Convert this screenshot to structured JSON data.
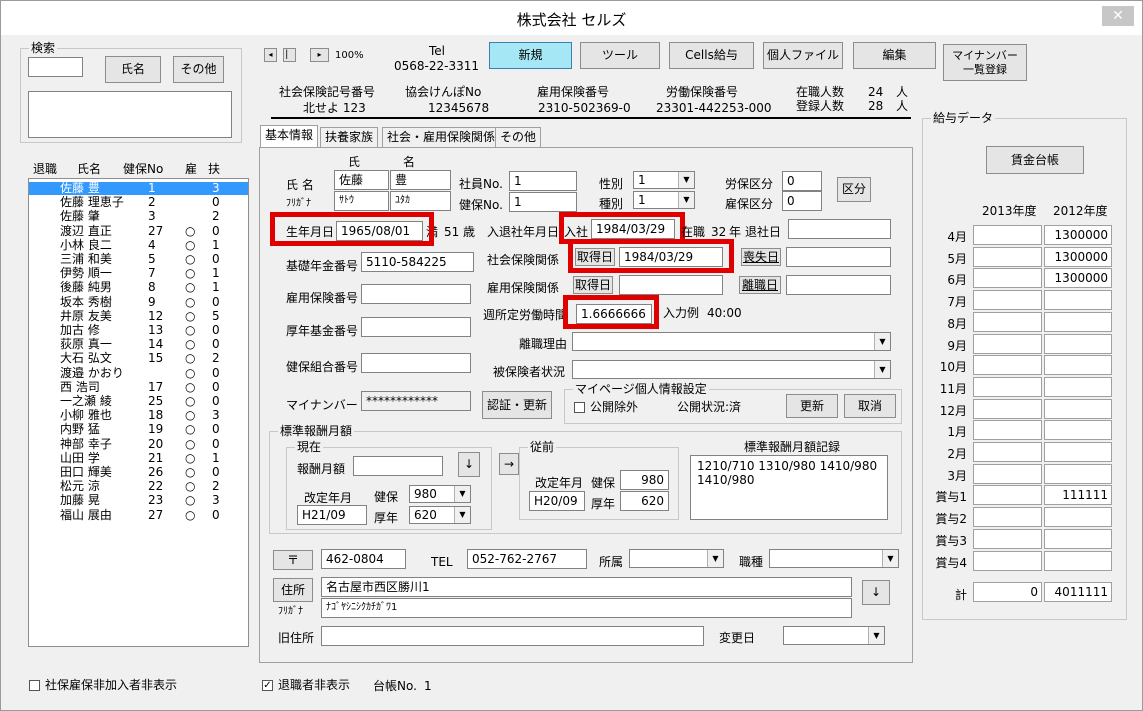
{
  "window": {
    "title": "株式会社 セルズ",
    "close_glyph": "✕"
  },
  "search": {
    "caption": "検索",
    "input_value": "",
    "name_button": "氏名",
    "other_button": "その他",
    "memo_value": ""
  },
  "list_headers": {
    "retired": "退職",
    "name": "氏名",
    "kenpo_no": "健保No",
    "koyo": "雇",
    "fuyo": "扶"
  },
  "employees": [
    {
      "name": "佐藤 豊",
      "no": "1",
      "koyo": "",
      "fuyo": "3"
    },
    {
      "name": "佐藤 理恵子",
      "no": "2",
      "koyo": "",
      "fuyo": "0"
    },
    {
      "name": "佐藤 肇",
      "no": "3",
      "koyo": "",
      "fuyo": "2"
    },
    {
      "name": "渡辺 直正",
      "no": "27",
      "koyo": "○",
      "fuyo": "0"
    },
    {
      "name": "小林 良二",
      "no": "4",
      "koyo": "○",
      "fuyo": "1"
    },
    {
      "name": "三浦 和美",
      "no": "5",
      "koyo": "○",
      "fuyo": "0"
    },
    {
      "name": "伊勢 順一",
      "no": "7",
      "koyo": "○",
      "fuyo": "1"
    },
    {
      "name": "後藤 純男",
      "no": "8",
      "koyo": "○",
      "fuyo": "1"
    },
    {
      "name": "坂本 秀樹",
      "no": "9",
      "koyo": "○",
      "fuyo": "0"
    },
    {
      "name": "井原 友美",
      "no": "12",
      "koyo": "○",
      "fuyo": "5"
    },
    {
      "name": "加古 修",
      "no": "13",
      "koyo": "○",
      "fuyo": "0"
    },
    {
      "name": "荻原 真一",
      "no": "14",
      "koyo": "○",
      "fuyo": "0"
    },
    {
      "name": "大石 弘文",
      "no": "15",
      "koyo": "○",
      "fuyo": "2"
    },
    {
      "name": "渡邉 かおり",
      "no": "",
      "koyo": "○",
      "fuyo": "0"
    },
    {
      "name": "西 浩司",
      "no": "17",
      "koyo": "○",
      "fuyo": "0"
    },
    {
      "name": "一之瀬 綾",
      "no": "25",
      "koyo": "○",
      "fuyo": "0"
    },
    {
      "name": "小柳 雅也",
      "no": "18",
      "koyo": "○",
      "fuyo": "3"
    },
    {
      "name": "内野 猛",
      "no": "19",
      "koyo": "○",
      "fuyo": "0"
    },
    {
      "name": "神部 幸子",
      "no": "20",
      "koyo": "○",
      "fuyo": "0"
    },
    {
      "name": "山田 学",
      "no": "21",
      "koyo": "○",
      "fuyo": "1"
    },
    {
      "name": "田口 輝美",
      "no": "26",
      "koyo": "○",
      "fuyo": "0"
    },
    {
      "name": "松元 涼",
      "no": "22",
      "koyo": "○",
      "fuyo": "2"
    },
    {
      "name": "加藤 晃",
      "no": "23",
      "koyo": "○",
      "fuyo": "3"
    },
    {
      "name": "福山 展由",
      "no": "27",
      "koyo": "○",
      "fuyo": "0"
    }
  ],
  "bottom": {
    "hide_uninsured_label": "社保雇保非加入者非表示",
    "hide_retired_label": "退職者非表示",
    "ledger_label": "台帳No.",
    "ledger_no": "1",
    "hide_retired_checked": "✓"
  },
  "toolbar": {
    "nav_first": "◂",
    "nav_prev": "▏",
    "nav_next": "▸",
    "zoom": "100%",
    "tel_label": "Tel",
    "tel_value": "0568-22-3311",
    "new_button": "新規",
    "tool_button": "ツール",
    "cells_button": "Cells給与",
    "personal_file_button": "個人ファイル",
    "edit_button": "編集",
    "mynumber_button_line1": "マイナンバー",
    "mynumber_button_line2": "一覧登録"
  },
  "company_info": {
    "shaho_label": "社会保険記号番号",
    "shaho_value": "北せよ 123",
    "kenpo_label": "協会けんぽNo",
    "kenpo_value": "12345678",
    "koyo_label": "雇用保険番号",
    "koyo_value": "2310-502369-0",
    "rodo_label": "労働保険番号",
    "rodo_value": "23301-442253-000",
    "zaishoku_label": "在職人数",
    "zaishoku_value": "24",
    "zaishoku_unit": "人",
    "toroku_label": "登録人数",
    "toroku_value": "28",
    "toroku_unit": "人"
  },
  "tabs": [
    "基本情報",
    "扶養家族",
    "社会・雇用保険関係",
    "その他"
  ],
  "basic": {
    "sei_header": "氏",
    "mei_header": "名",
    "name_label": "氏 名",
    "sei": "佐藤",
    "mei": "豊",
    "furigana_label": "ﾌﾘｶﾞﾅ",
    "sei_kana": "ｻﾄｳ",
    "mei_kana": "ﾕﾀｶ",
    "shain_no_label": "社員No.",
    "shain_no": "1",
    "kenpo_no_label": "健保No.",
    "kenpo_no": "1",
    "seibetsu_label": "性別",
    "seibetsu": "1",
    "shubetsu_label": "種別",
    "shubetsu": "1",
    "rouho_label": "労保区分",
    "rouho": "0",
    "koho_label": "雇保区分",
    "koho": "0",
    "kubun_button": "区分",
    "birth_label": "生年月日",
    "birth": "1965/08/01",
    "age_prefix": "満",
    "age": "51",
    "age_unit": "歳",
    "nyutai_label": "入退社年月日",
    "nyusha_label": "入社",
    "nyusha": "1984/03/29",
    "zaishoku_label": "在職",
    "zaishoku_years": "32",
    "zaishoku_unit": "年",
    "taisha_label": "退社日",
    "taisha": "",
    "kiso_label": "基礎年金番号",
    "kiso": "5110-584225",
    "shaho_rel_label": "社会保険関係",
    "shutoku_button": "取得日",
    "shutoku": "1984/03/29",
    "soshitsu_button": "喪失日",
    "soshitsu": "",
    "koyo_rel_label": "雇用保険関係",
    "koyo_shutoku_button": "取得日",
    "koyo_shutoku": "",
    "rishoku_button": "離職日",
    "rishoku": "",
    "koyo_no_label": "雇用保険番号",
    "koyo_no": "",
    "shuro_label": "週所定労働時間",
    "shuro": "1.6666666",
    "shuro_hint_label": "入力例",
    "shuro_hint": "40:00",
    "kosei_label": "厚年基金番号",
    "kosei": "",
    "rishoku_riyu_label": "離職理由",
    "rishoku_riyu": "",
    "kumiai_label": "健保組合番号",
    "kumiai": "",
    "hihokensha_label": "被保険者状況",
    "hihokensha": "",
    "mynumber_label": "マイナンバー",
    "mynumber": "************",
    "ninsho_button": "認証・更新",
    "mypage_caption": "マイページ個人情報設定",
    "kokai_jogai_label": "公開除外",
    "kokai_status": "公開状況:済",
    "koshin_button": "更新",
    "torikeshi_button": "取消"
  },
  "hoshu": {
    "caption": "標準報酬月額",
    "current_caption": "現在",
    "getsugaku_label": "報酬月額",
    "getsugaku": "",
    "down_button": "↓",
    "kaitei_label": "改定年月",
    "kaitei": "H21/09",
    "kenpo_label": "健保",
    "kenpo": "980",
    "kosei_label": "厚年",
    "kosei": "620",
    "arrow_button": "→",
    "before_caption": "従前",
    "before_kaitei_label": "改定年月",
    "before_kaitei": "H20/09",
    "before_kenpo_label": "健保",
    "before_kenpo": "980",
    "before_kosei_label": "厚年",
    "before_kosei": "620",
    "record_label": "標準報酬月額記録",
    "record_line1": "1210/710  1310/980 1410/980",
    "record_line2": "1410/980"
  },
  "address": {
    "zip_button": "〒",
    "zip": "462-0804",
    "tel_label": "TEL",
    "tel": "052-762-2767",
    "shozoku_label": "所属",
    "shozoku": "",
    "shokushu_label": "職種",
    "shokushu": "",
    "jusho_button": "住所",
    "furigana_label": "ﾌﾘｶﾞﾅ",
    "jusho": "名古屋市西区勝川1",
    "jusho_kana": "ﾅｺﾞﾔｼﾆｼｸｶﾁｶﾞﾜ1",
    "down_button": "↓",
    "kyu_label": "旧住所",
    "kyu": "",
    "henko_label": "変更日",
    "henko": ""
  },
  "pay": {
    "caption": "給与データ",
    "ledger_button": "賃金台帳",
    "year1": "2013年度",
    "year2": "2012年度",
    "months": [
      "4月",
      "5月",
      "6月",
      "7月",
      "8月",
      "9月",
      "10月",
      "11月",
      "12月",
      "1月",
      "2月",
      "3月",
      "賞与1",
      "賞与2",
      "賞与3",
      "賞与4"
    ],
    "col1": [
      "",
      "",
      "",
      "",
      "",
      "",
      "",
      "",
      "",
      "",
      "",
      "",
      "",
      "",
      "",
      ""
    ],
    "col2": [
      "1300000",
      "1300000",
      "1300000",
      "",
      "",
      "",
      "",
      "",
      "",
      "",
      "",
      "",
      "111111",
      "",
      "",
      ""
    ],
    "total_label": "計",
    "total1": "0",
    "total2": "4011111"
  },
  "colors": {
    "selection": "#3399ff",
    "highlight": "#e00000",
    "new_button": "#a6e7f5"
  }
}
